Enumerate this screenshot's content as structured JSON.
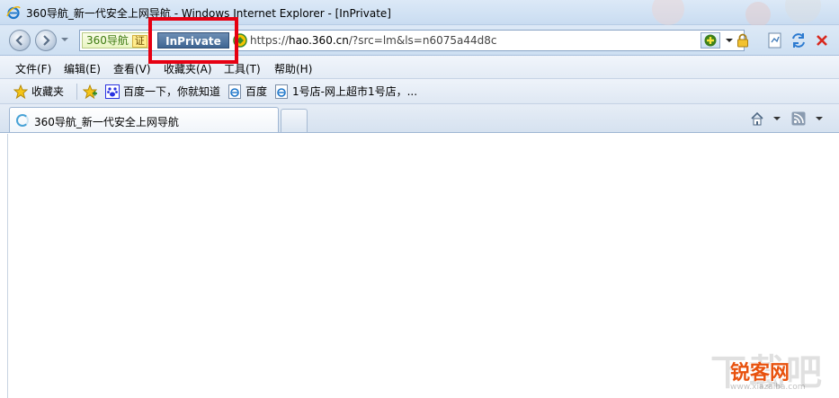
{
  "window": {
    "title": "360导航_新一代安全上网导航 - Windows Internet Explorer - [InPrivate]"
  },
  "navbar": {
    "site_badge": "360导航",
    "cert_badge": "证",
    "inprivate_label": "InPrivate",
    "url_prefix": "https://",
    "url_domain": "hao.360.cn",
    "url_rest": "/?src=lm&ls=n6075a44d8c"
  },
  "menu": {
    "items": [
      "文件(F)",
      "编辑(E)",
      "查看(V)",
      "收藏夹(A)",
      "工具(T)",
      "帮助(H)"
    ]
  },
  "favorites": {
    "label": "收藏夹",
    "items": [
      "百度一下，你就知道",
      "百度",
      "1号店-网上超市1号店，..."
    ]
  },
  "tabs": {
    "active_title": "360导航_新一代安全上网导航"
  },
  "watermark": {
    "big": "下载吧",
    "logo": "锐客网",
    "url": "www.xiazaiba.com"
  },
  "colors": {
    "highlight": "#e60012",
    "inprivate_bg": "#3f6592",
    "watermark_logo": "#e8520e"
  }
}
